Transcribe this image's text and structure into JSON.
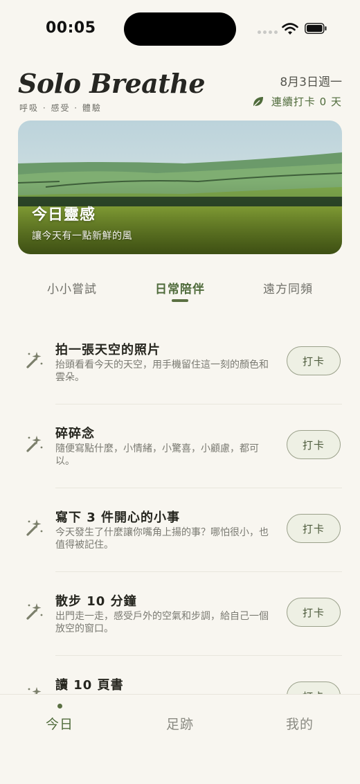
{
  "status": {
    "time": "00:05"
  },
  "header": {
    "brand": "Solo Breathe",
    "tagline": "呼吸 · 感受 · 體驗",
    "date": "8月3日週一",
    "streak": "連續打卡 0 天"
  },
  "hero": {
    "title": "今日靈感",
    "subtitle": "讓今天有一點新鮮的風"
  },
  "tabs": [
    {
      "label": "小小嘗試",
      "active": false
    },
    {
      "label": "日常陪伴",
      "active": true
    },
    {
      "label": "遠方同頻",
      "active": false
    }
  ],
  "items": [
    {
      "title": "拍一張天空的照片",
      "desc": "抬頭看看今天的天空，用手機留住這一刻的顏色和雲朵。",
      "button": "打卡"
    },
    {
      "title": "碎碎念",
      "desc": "隨便寫點什麼，小情緒，小驚喜，小顧慮，都可以。",
      "button": "打卡"
    },
    {
      "title": "寫下 3 件開心的小事",
      "desc": "今天發生了什麼讓你嘴角上揚的事？哪怕很小，也值得被記住。",
      "button": "打卡"
    },
    {
      "title": "散步 10 分鐘",
      "desc": "出門走一走，感受戶外的空氣和步調，給自己一個放空的窗口。",
      "button": "打卡"
    },
    {
      "title": "讀 10 頁書",
      "desc": "",
      "button": "打卡"
    }
  ],
  "bottom_nav": [
    {
      "label": "今日",
      "active": true
    },
    {
      "label": "足跡",
      "active": false
    },
    {
      "label": "我的",
      "active": false
    }
  ],
  "colors": {
    "accent": "#4f6b3b",
    "background": "#f8f6f0"
  }
}
